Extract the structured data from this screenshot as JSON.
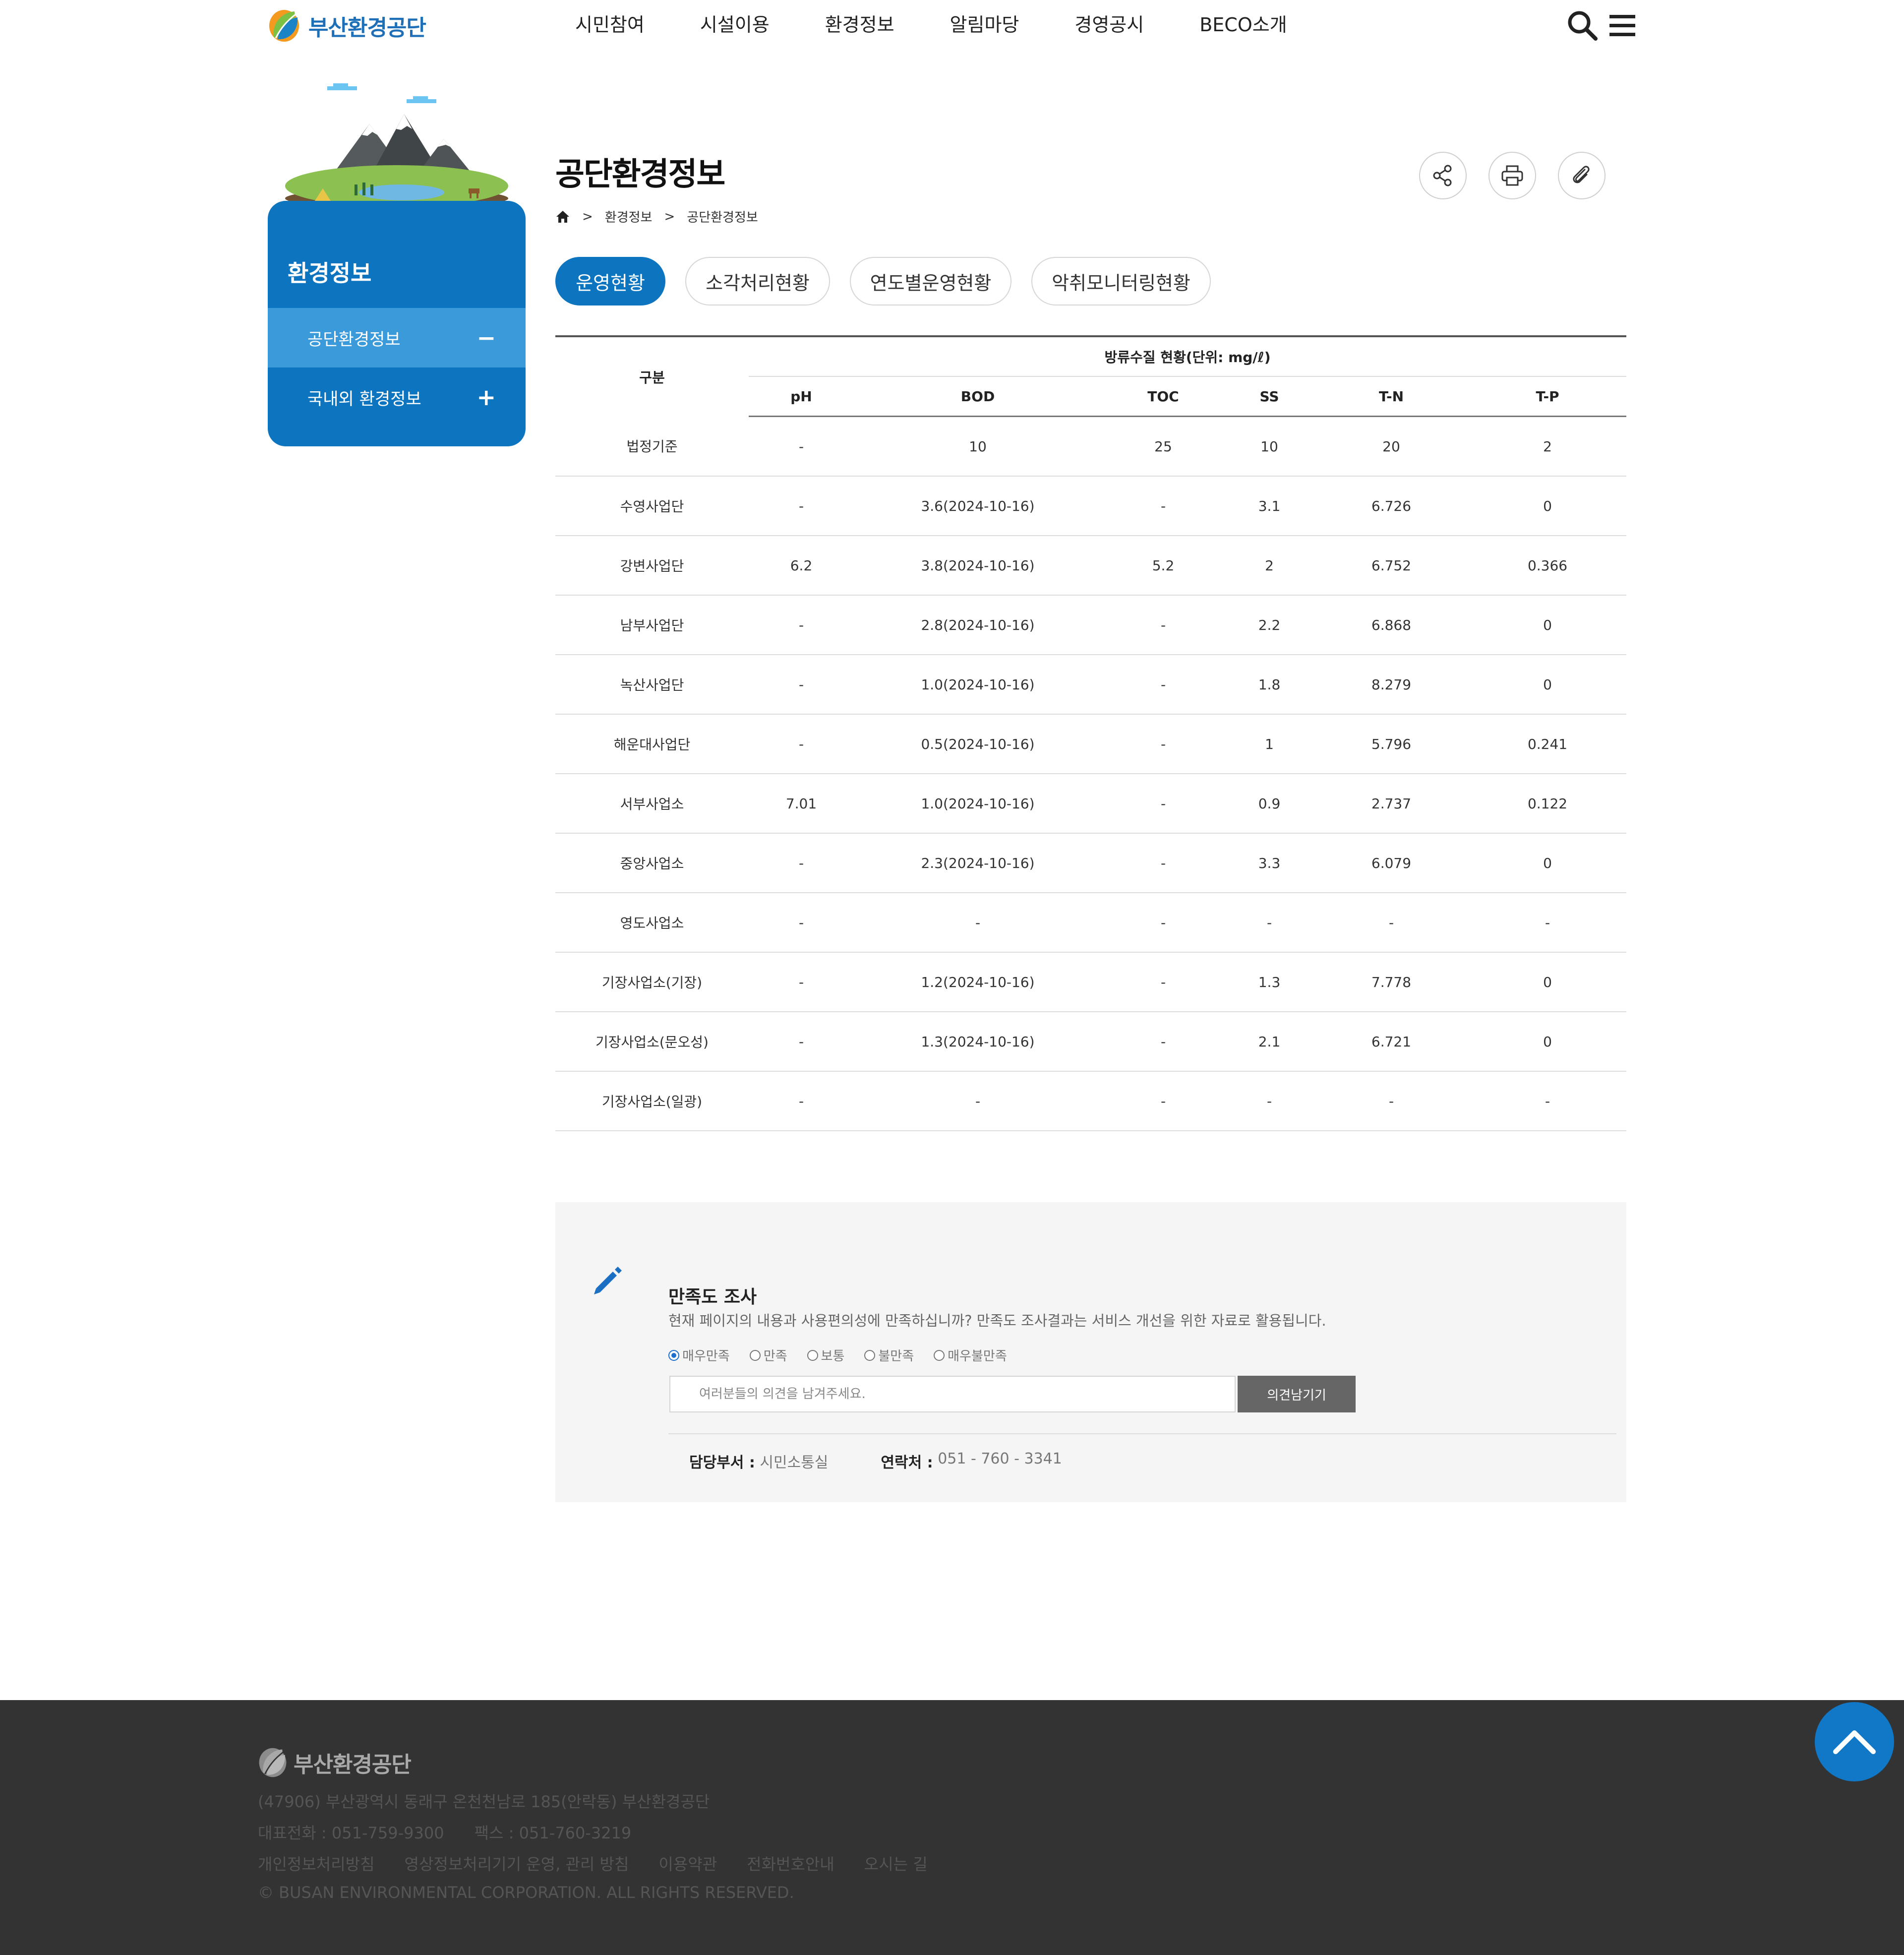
{
  "header": {
    "logo_text": "부산환경공단",
    "nav": [
      "시민참여",
      "시설이용",
      "환경정보",
      "알림마당",
      "경영공시",
      "BECO소개"
    ],
    "search_icon": "search-icon",
    "menu_icon": "hamburger-menu-icon"
  },
  "sidebar": {
    "title": "환경정보",
    "items": [
      {
        "label": "공단환경정보",
        "sign": "−",
        "active": true
      },
      {
        "label": "국내외 환경정보",
        "sign": "+",
        "active": false
      }
    ],
    "accent_color": "#0d74c0"
  },
  "page": {
    "title": "공단환경정보",
    "breadcrumb": {
      "home_icon": "home-icon",
      "separator": ">",
      "items": [
        "환경정보",
        "공단환경정보"
      ]
    },
    "tools": [
      "share-icon",
      "print-icon",
      "attach-icon"
    ]
  },
  "tabs": [
    {
      "label": "운영현황",
      "active": true
    },
    {
      "label": "소각처리현황",
      "active": false
    },
    {
      "label": "연도별운영현황",
      "active": false
    },
    {
      "label": "악취모니터링현황",
      "active": false
    }
  ],
  "table": {
    "category_header": "구분",
    "group_header": "방류수질 현황(단위: mg/ℓ)",
    "columns": [
      "pH",
      "BOD",
      "TOC",
      "SS",
      "T-N",
      "T-P"
    ],
    "rows": [
      [
        "법정기준",
        "-",
        "10",
        "25",
        "10",
        "20",
        "2"
      ],
      [
        "수영사업단",
        "-",
        "3.6(2024-10-16)",
        "-",
        "3.1",
        "6.726",
        "0"
      ],
      [
        "강변사업단",
        "6.2",
        "3.8(2024-10-16)",
        "5.2",
        "2",
        "6.752",
        "0.366"
      ],
      [
        "남부사업단",
        "-",
        "2.8(2024-10-16)",
        "-",
        "2.2",
        "6.868",
        "0"
      ],
      [
        "녹산사업단",
        "-",
        "1.0(2024-10-16)",
        "-",
        "1.8",
        "8.279",
        "0"
      ],
      [
        "해운대사업단",
        "-",
        "0.5(2024-10-16)",
        "-",
        "1",
        "5.796",
        "0.241"
      ],
      [
        "서부사업소",
        "7.01",
        "1.0(2024-10-16)",
        "-",
        "0.9",
        "2.737",
        "0.122"
      ],
      [
        "중앙사업소",
        "-",
        "2.3(2024-10-16)",
        "-",
        "3.3",
        "6.079",
        "0"
      ],
      [
        "영도사업소",
        "-",
        "-",
        "-",
        "-",
        "-",
        "-"
      ],
      [
        "기장사업소(기장)",
        "-",
        "1.2(2024-10-16)",
        "-",
        "1.3",
        "7.778",
        "0"
      ],
      [
        "기장사업소(문오성)",
        "-",
        "1.3(2024-10-16)",
        "-",
        "2.1",
        "6.721",
        "0"
      ],
      [
        "기장사업소(일광)",
        "-",
        "-",
        "-",
        "-",
        "-",
        "-"
      ]
    ]
  },
  "survey": {
    "title": "만족도 조사",
    "description": "현재 페이지의 내용과 사용편의성에 만족하십니까? 만족도 조사결과는 서비스 개선을 위한 자료로 활용됩니다.",
    "options": [
      "매우만족",
      "만족",
      "보통",
      "불만족",
      "매우불만족"
    ],
    "selected_option": "매우만족",
    "input_value": "",
    "input_placeholder": "여러분들의 의견을 남겨주세요.",
    "submit_label": "의견남기기",
    "dept_label": "담당부서 :",
    "dept_value": "시민소통실",
    "contact_label": "연락처 :",
    "contact_value": "051 - 760 - 3341"
  },
  "footer": {
    "logo_text": "부산환경공단",
    "address": "(47906) 부산광역시 동래구 온천천남로 185(안락동) 부산환경공단",
    "contact": "대표전화 : 051-759-9300      팩스 : 051-760-3219",
    "links": [
      "개인정보처리방침",
      "영상정보처리기기 운영, 관리 방침",
      "이용약관",
      "전화번호안내",
      "오시는 길"
    ],
    "copyright": "© BUSAN ENVIRONMENTAL CORPORATION. ALL RIGHTS RESERVED."
  }
}
